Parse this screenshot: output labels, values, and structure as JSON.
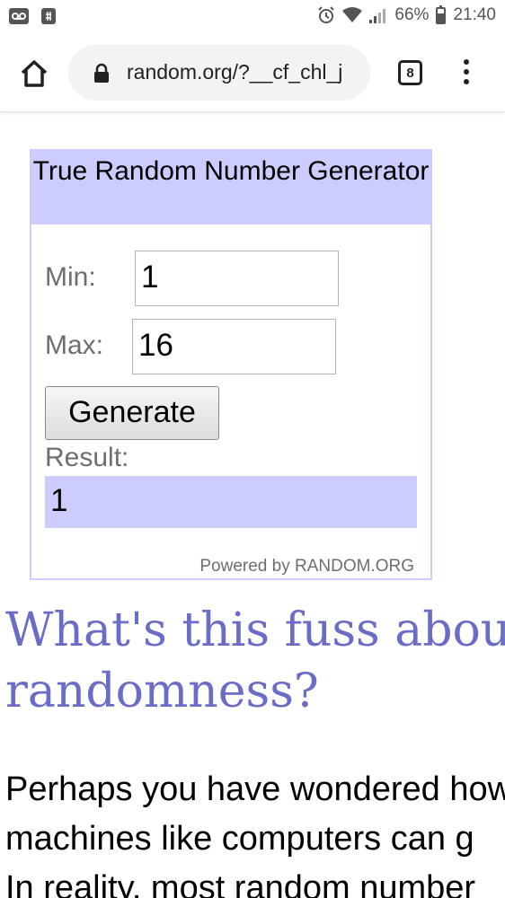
{
  "status_bar": {
    "battery": "66%",
    "battery_level_percent": 66,
    "time": "21:40",
    "icons": [
      "voicemail-icon",
      "sim-icon",
      "alarm-icon",
      "wifi-icon",
      "signal-icon",
      "battery-icon"
    ]
  },
  "browser": {
    "url": "random.org/?__cf_chl_j",
    "tab_count": "8",
    "icons": [
      "home-icon",
      "lock-icon",
      "tabs-icon",
      "overflow-menu-icon"
    ]
  },
  "widget": {
    "title": "True Random Number Generator",
    "min_label": "Min:",
    "min_value": "1",
    "max_label": "Max:",
    "max_value": "16",
    "generate_label": "Generate",
    "result_label": "Result:",
    "result_value": "1",
    "powered_by": "Powered by RANDOM.ORG",
    "colors": {
      "accent_bg": "#ccccff",
      "label_text": "#6e6e6e"
    }
  },
  "article": {
    "heading": "What's this fuss about true randomness?",
    "paragraph_lines": [
      "Perhaps you have wondered how",
      "machines like computers can g",
      "In reality, most random number"
    ],
    "colors": {
      "heading": "#6b6bc8"
    }
  }
}
